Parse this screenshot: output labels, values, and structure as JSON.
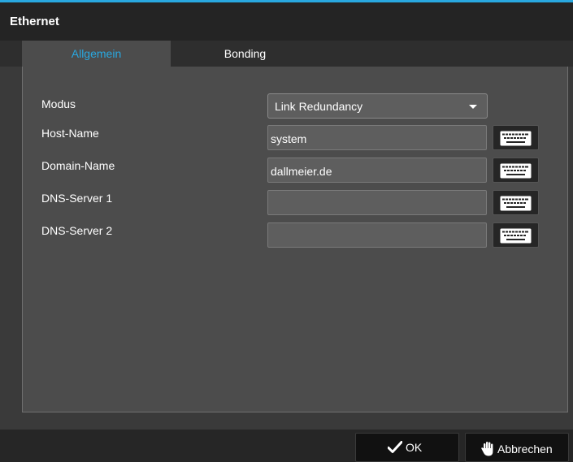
{
  "window": {
    "title": "Ethernet",
    "accent_color": "#29a8e0"
  },
  "tabs": [
    {
      "label": "Allgemein",
      "active": true
    },
    {
      "label": "Bonding",
      "active": false
    }
  ],
  "form": {
    "modus": {
      "label": "Modus",
      "value": "Link Redundancy"
    },
    "host_name": {
      "label": "Host-Name",
      "value": "system"
    },
    "domain_name": {
      "label": "Domain-Name",
      "value": "dallmeier.de"
    },
    "dns_server_1": {
      "label": "DNS-Server 1",
      "value": ""
    },
    "dns_server_2": {
      "label": "DNS-Server 2",
      "value": ""
    }
  },
  "footer": {
    "ok_label": "OK",
    "ok_icon": "checkmark-icon",
    "cancel_label": "Abbrechen",
    "cancel_icon": "hand-icon"
  }
}
